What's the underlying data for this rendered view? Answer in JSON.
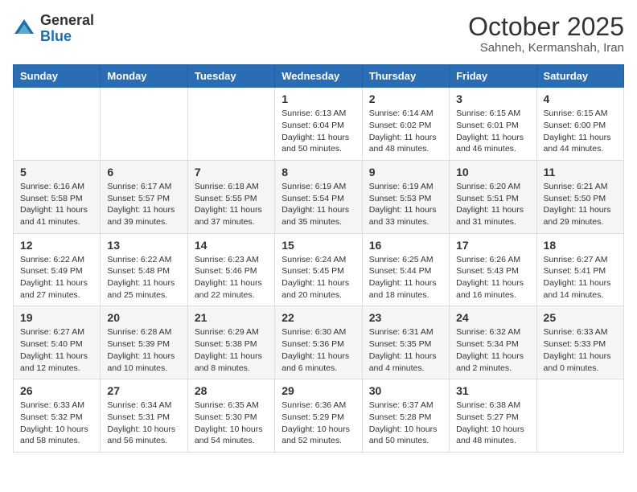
{
  "header": {
    "logo_line1": "General",
    "logo_line2": "Blue",
    "month": "October 2025",
    "location": "Sahneh, Kermanshah, Iran"
  },
  "weekdays": [
    "Sunday",
    "Monday",
    "Tuesday",
    "Wednesday",
    "Thursday",
    "Friday",
    "Saturday"
  ],
  "weeks": [
    [
      {
        "day": "",
        "info": ""
      },
      {
        "day": "",
        "info": ""
      },
      {
        "day": "",
        "info": ""
      },
      {
        "day": "1",
        "info": "Sunrise: 6:13 AM\nSunset: 6:04 PM\nDaylight: 11 hours\nand 50 minutes."
      },
      {
        "day": "2",
        "info": "Sunrise: 6:14 AM\nSunset: 6:02 PM\nDaylight: 11 hours\nand 48 minutes."
      },
      {
        "day": "3",
        "info": "Sunrise: 6:15 AM\nSunset: 6:01 PM\nDaylight: 11 hours\nand 46 minutes."
      },
      {
        "day": "4",
        "info": "Sunrise: 6:15 AM\nSunset: 6:00 PM\nDaylight: 11 hours\nand 44 minutes."
      }
    ],
    [
      {
        "day": "5",
        "info": "Sunrise: 6:16 AM\nSunset: 5:58 PM\nDaylight: 11 hours\nand 41 minutes."
      },
      {
        "day": "6",
        "info": "Sunrise: 6:17 AM\nSunset: 5:57 PM\nDaylight: 11 hours\nand 39 minutes."
      },
      {
        "day": "7",
        "info": "Sunrise: 6:18 AM\nSunset: 5:55 PM\nDaylight: 11 hours\nand 37 minutes."
      },
      {
        "day": "8",
        "info": "Sunrise: 6:19 AM\nSunset: 5:54 PM\nDaylight: 11 hours\nand 35 minutes."
      },
      {
        "day": "9",
        "info": "Sunrise: 6:19 AM\nSunset: 5:53 PM\nDaylight: 11 hours\nand 33 minutes."
      },
      {
        "day": "10",
        "info": "Sunrise: 6:20 AM\nSunset: 5:51 PM\nDaylight: 11 hours\nand 31 minutes."
      },
      {
        "day": "11",
        "info": "Sunrise: 6:21 AM\nSunset: 5:50 PM\nDaylight: 11 hours\nand 29 minutes."
      }
    ],
    [
      {
        "day": "12",
        "info": "Sunrise: 6:22 AM\nSunset: 5:49 PM\nDaylight: 11 hours\nand 27 minutes."
      },
      {
        "day": "13",
        "info": "Sunrise: 6:22 AM\nSunset: 5:48 PM\nDaylight: 11 hours\nand 25 minutes."
      },
      {
        "day": "14",
        "info": "Sunrise: 6:23 AM\nSunset: 5:46 PM\nDaylight: 11 hours\nand 22 minutes."
      },
      {
        "day": "15",
        "info": "Sunrise: 6:24 AM\nSunset: 5:45 PM\nDaylight: 11 hours\nand 20 minutes."
      },
      {
        "day": "16",
        "info": "Sunrise: 6:25 AM\nSunset: 5:44 PM\nDaylight: 11 hours\nand 18 minutes."
      },
      {
        "day": "17",
        "info": "Sunrise: 6:26 AM\nSunset: 5:43 PM\nDaylight: 11 hours\nand 16 minutes."
      },
      {
        "day": "18",
        "info": "Sunrise: 6:27 AM\nSunset: 5:41 PM\nDaylight: 11 hours\nand 14 minutes."
      }
    ],
    [
      {
        "day": "19",
        "info": "Sunrise: 6:27 AM\nSunset: 5:40 PM\nDaylight: 11 hours\nand 12 minutes."
      },
      {
        "day": "20",
        "info": "Sunrise: 6:28 AM\nSunset: 5:39 PM\nDaylight: 11 hours\nand 10 minutes."
      },
      {
        "day": "21",
        "info": "Sunrise: 6:29 AM\nSunset: 5:38 PM\nDaylight: 11 hours\nand 8 minutes."
      },
      {
        "day": "22",
        "info": "Sunrise: 6:30 AM\nSunset: 5:36 PM\nDaylight: 11 hours\nand 6 minutes."
      },
      {
        "day": "23",
        "info": "Sunrise: 6:31 AM\nSunset: 5:35 PM\nDaylight: 11 hours\nand 4 minutes."
      },
      {
        "day": "24",
        "info": "Sunrise: 6:32 AM\nSunset: 5:34 PM\nDaylight: 11 hours\nand 2 minutes."
      },
      {
        "day": "25",
        "info": "Sunrise: 6:33 AM\nSunset: 5:33 PM\nDaylight: 11 hours\nand 0 minutes."
      }
    ],
    [
      {
        "day": "26",
        "info": "Sunrise: 6:33 AM\nSunset: 5:32 PM\nDaylight: 10 hours\nand 58 minutes."
      },
      {
        "day": "27",
        "info": "Sunrise: 6:34 AM\nSunset: 5:31 PM\nDaylight: 10 hours\nand 56 minutes."
      },
      {
        "day": "28",
        "info": "Sunrise: 6:35 AM\nSunset: 5:30 PM\nDaylight: 10 hours\nand 54 minutes."
      },
      {
        "day": "29",
        "info": "Sunrise: 6:36 AM\nSunset: 5:29 PM\nDaylight: 10 hours\nand 52 minutes."
      },
      {
        "day": "30",
        "info": "Sunrise: 6:37 AM\nSunset: 5:28 PM\nDaylight: 10 hours\nand 50 minutes."
      },
      {
        "day": "31",
        "info": "Sunrise: 6:38 AM\nSunset: 5:27 PM\nDaylight: 10 hours\nand 48 minutes."
      },
      {
        "day": "",
        "info": ""
      }
    ]
  ]
}
